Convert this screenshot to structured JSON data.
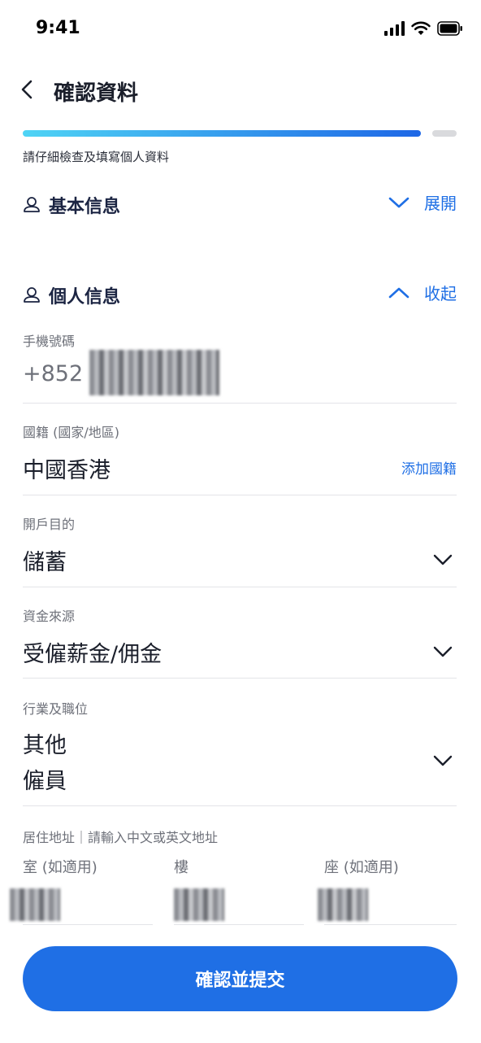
{
  "status_bar": {
    "time": "9:41"
  },
  "nav": {
    "title": "確認資料"
  },
  "progress": {
    "value": 0.917,
    "hint": "請仔細檢查及填寫個人資料"
  },
  "sections": {
    "basic": {
      "title": "基本信息",
      "toggle_label": "展開"
    },
    "personal": {
      "title": "個人信息",
      "toggle_label": "收起"
    }
  },
  "fields": {
    "phone": {
      "label": "手機號碼",
      "prefix": "+852"
    },
    "nationality": {
      "label": "國籍 (國家/地區)",
      "value": "中國香港",
      "action": "添加國籍"
    },
    "purpose": {
      "label": "開戶目的",
      "value": "儲蓄"
    },
    "funds": {
      "label": "資金來源",
      "value": "受僱薪金/佣金"
    },
    "occupation": {
      "label": "行業及職位",
      "value_line1": "其他",
      "value_line2": "僱員"
    }
  },
  "address": {
    "label": "居住地址｜請輸入中文或英文地址",
    "room": "室 (如適用)",
    "floor": "樓",
    "block": "座 (如適用)"
  },
  "submit": {
    "label": "確認並提交"
  },
  "colors": {
    "accent": "#1f6fe5",
    "progress_start": "#4fd4f5",
    "progress_end": "#1e67e6"
  }
}
